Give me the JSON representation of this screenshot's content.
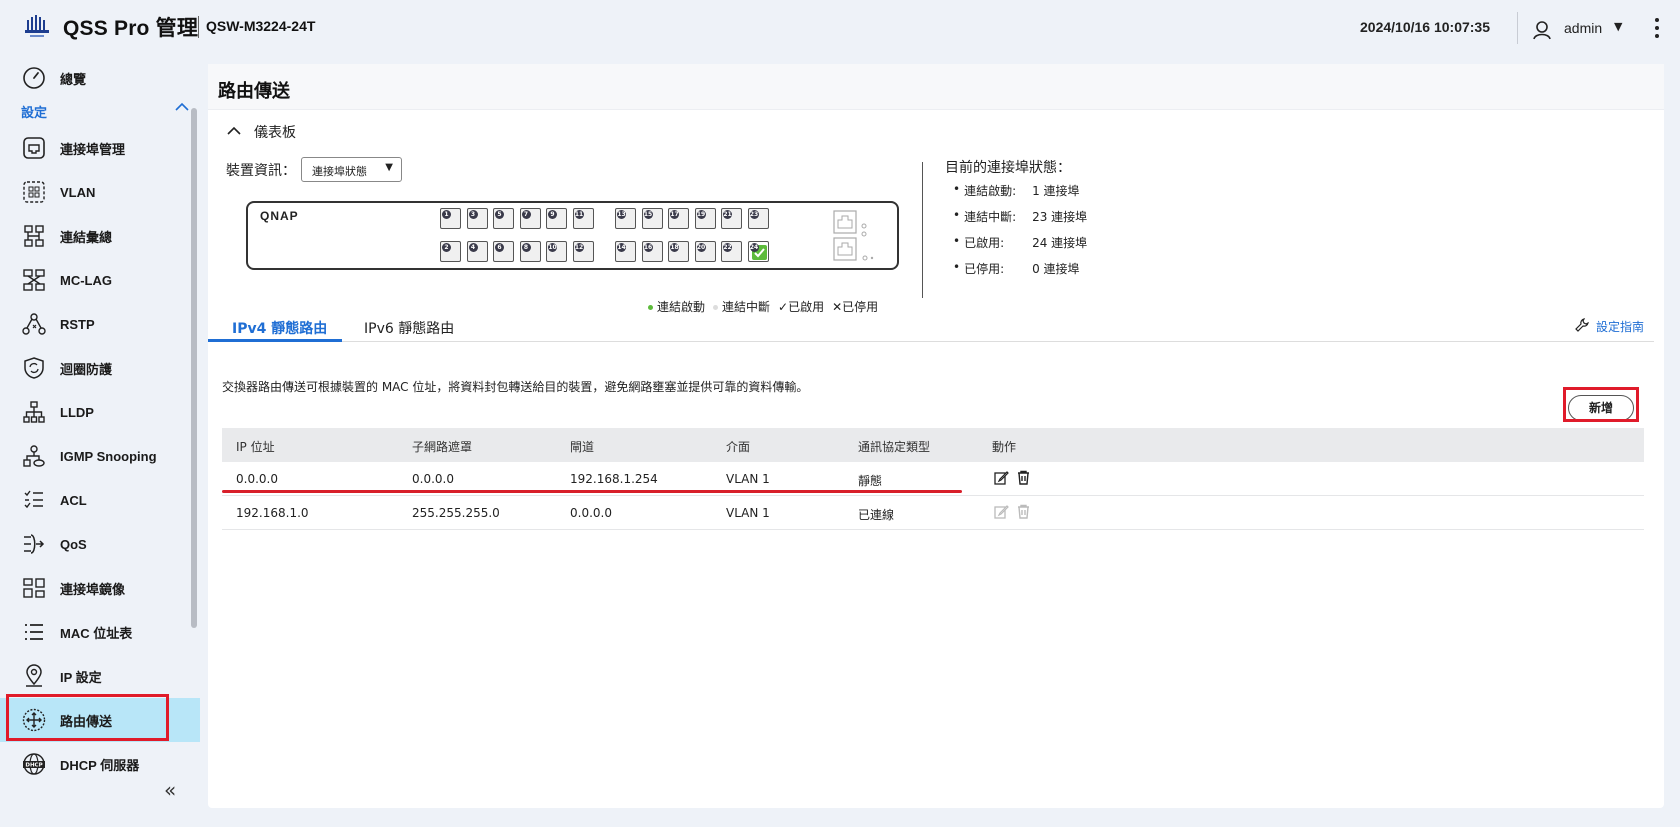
{
  "header": {
    "app_title": "QSS Pro 管理",
    "model": "QSW-M3224-24T",
    "datetime": "2024/10/16 10:07:35",
    "user": "admin"
  },
  "sidebar": {
    "overview": "總覽",
    "section": "設定",
    "items": [
      {
        "label": "連接埠管理",
        "icon": "port-icon"
      },
      {
        "label": "VLAN",
        "icon": "vlan-icon"
      },
      {
        "label": "連結彙總",
        "icon": "link-aggregation-icon"
      },
      {
        "label": "MC-LAG",
        "icon": "mc-lag-icon"
      },
      {
        "label": "RSTP",
        "icon": "rstp-icon"
      },
      {
        "label": "迴圈防護",
        "icon": "loop-protection-icon"
      },
      {
        "label": "LLDP",
        "icon": "lldp-icon"
      },
      {
        "label": "IGMP Snooping",
        "icon": "igmp-icon"
      },
      {
        "label": "ACL",
        "icon": "acl-icon"
      },
      {
        "label": "QoS",
        "icon": "qos-icon"
      },
      {
        "label": "連接埠鏡像",
        "icon": "mirror-icon"
      },
      {
        "label": "MAC 位址表",
        "icon": "mac-table-icon"
      },
      {
        "label": "IP 設定",
        "icon": "ip-settings-icon"
      },
      {
        "label": "路由傳送",
        "icon": "routing-icon"
      },
      {
        "label": "DHCP 伺服器",
        "icon": "dhcp-icon"
      }
    ],
    "active_index": 13
  },
  "main": {
    "page_title": "路由傳送",
    "dashboard_label": "儀表板",
    "device_label": "裝置資訊：",
    "device_select": "連接埠狀態",
    "switch_brand": "QNAP",
    "ports_top": [
      "1",
      "3",
      "5",
      "7",
      "9",
      "11",
      "13",
      "15",
      "17",
      "19",
      "21",
      "23"
    ],
    "ports_bottom": [
      "2",
      "4",
      "6",
      "8",
      "10",
      "12",
      "14",
      "16",
      "18",
      "20",
      "22",
      "24"
    ],
    "port_up": "24",
    "legend": {
      "up": "連結啟動",
      "down": "連結中斷",
      "enabled": "✓已啟用",
      "disabled": "✕已停用"
    },
    "status_title": "目前的連接埠狀態：",
    "status": [
      {
        "k": "連結啟動:",
        "v": "1 連接埠"
      },
      {
        "k": "連結中斷:",
        "v": "23 連接埠"
      },
      {
        "k": "已啟用:",
        "v": "24 連接埠"
      },
      {
        "k": "已停用:",
        "v": "0 連接埠"
      }
    ],
    "tabs": [
      "IPv4 靜態路由",
      "IPv6 靜態路由"
    ],
    "guide": "設定指南",
    "description": "交換器路由傳送可根據裝置的 MAC 位址，將資料封包轉送給目的裝置，避免網路壅塞並提供可靠的資料傳輸。",
    "add_button": "新增",
    "table": {
      "headers": [
        "IP 位址",
        "子網路遮罩",
        "閘道",
        "介面",
        "通訊協定類型",
        "動作"
      ],
      "rows": [
        [
          "0.0.0.0",
          "0.0.0.0",
          "192.168.1.254",
          "VLAN 1",
          "靜態"
        ],
        [
          "192.168.1.0",
          "255.255.255.0",
          "0.0.0.0",
          "VLAN 1",
          "已連線"
        ]
      ]
    }
  },
  "colors": {
    "accent": "#1f6ed4",
    "highlight": "#e01b2a",
    "active_bg": "#b8e6f8",
    "port_up": "#5dbb3b"
  }
}
